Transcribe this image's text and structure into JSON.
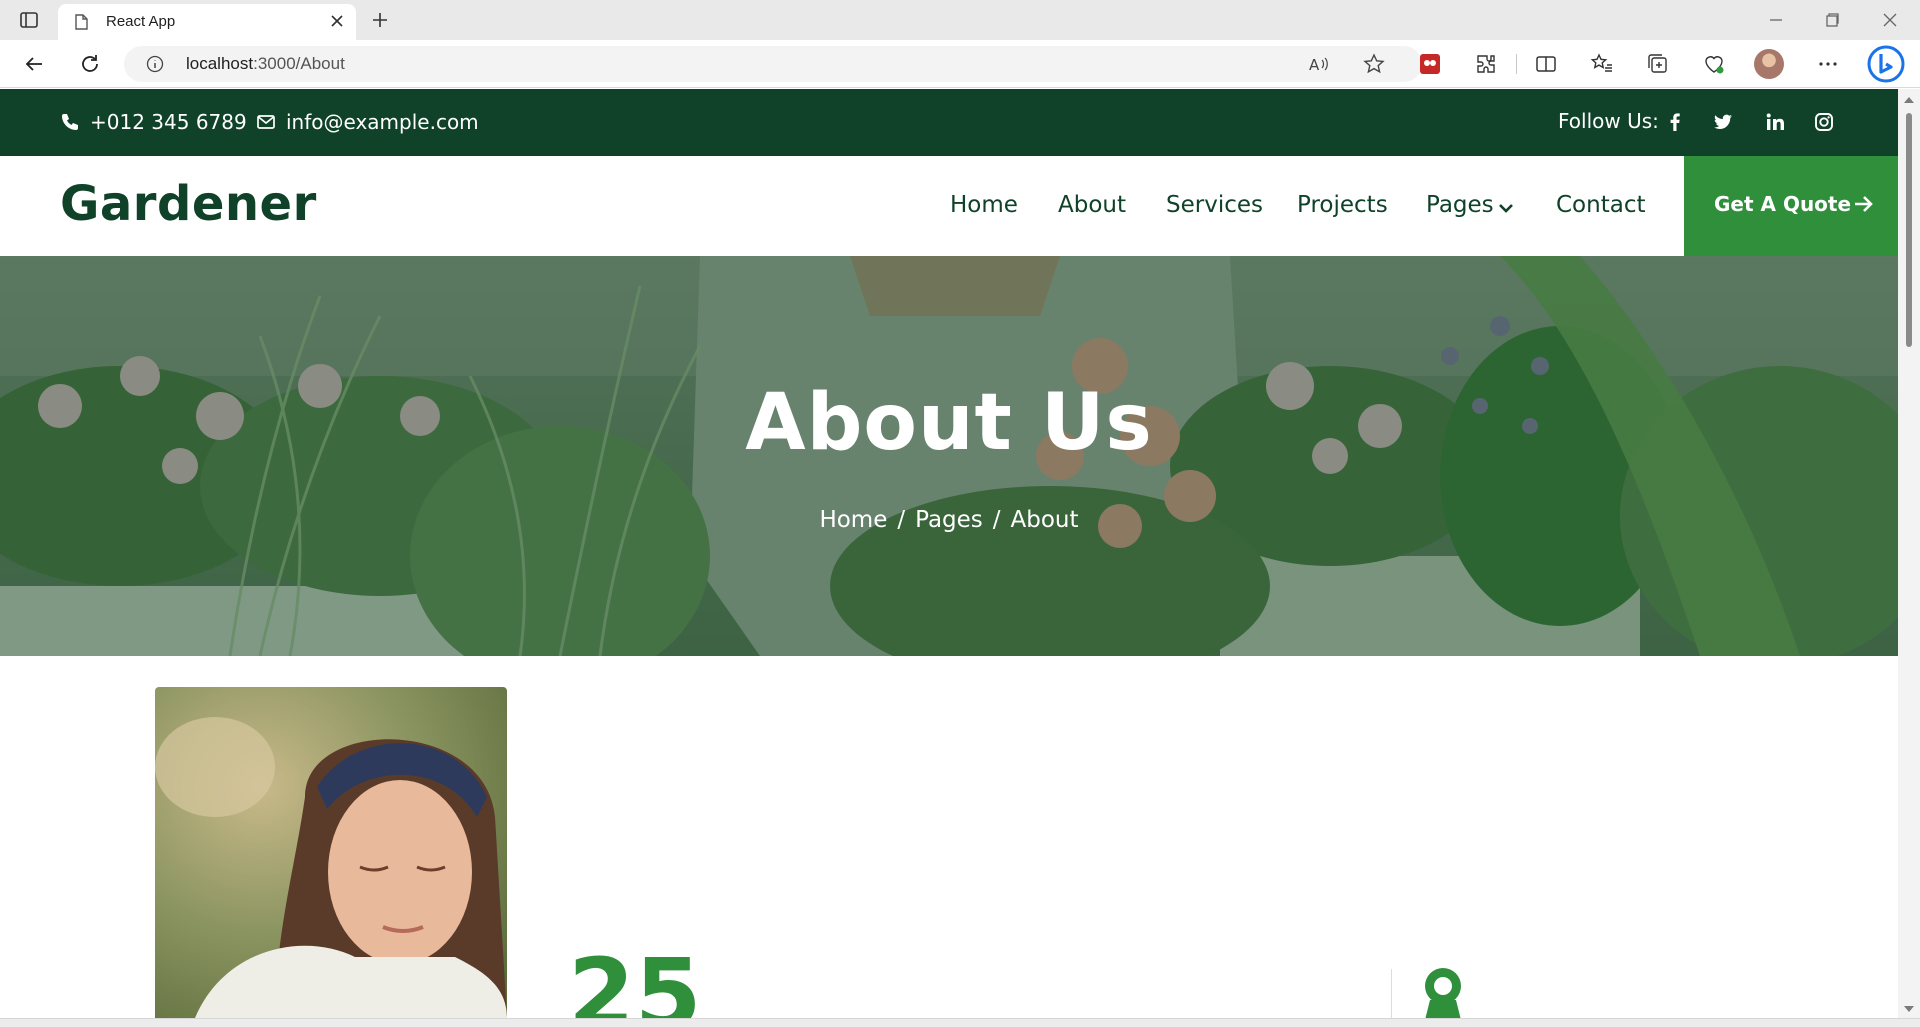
{
  "browser": {
    "tab_title": "React App",
    "url_host": "localhost",
    "url_path": ":3000/About"
  },
  "topbar": {
    "phone": "+012 345 6789",
    "email": "info@example.com",
    "follow_label": "Follow Us:",
    "socials": [
      "facebook-icon",
      "twitter-icon",
      "linkedin-icon",
      "instagram-icon"
    ]
  },
  "nav": {
    "brand": "Gardener",
    "items": [
      "Home",
      "About",
      "Services",
      "Projects",
      "Pages",
      "Contact"
    ],
    "cta": "Get A Quote"
  },
  "hero": {
    "title": "About Us",
    "breadcrumb": [
      "Home",
      "Pages",
      "About"
    ],
    "separator": "/"
  },
  "about": {
    "counter": "25"
  },
  "colors": {
    "dark_green": "#0f4229",
    "accent_green": "#2f8f3a",
    "white": "#ffffff"
  }
}
